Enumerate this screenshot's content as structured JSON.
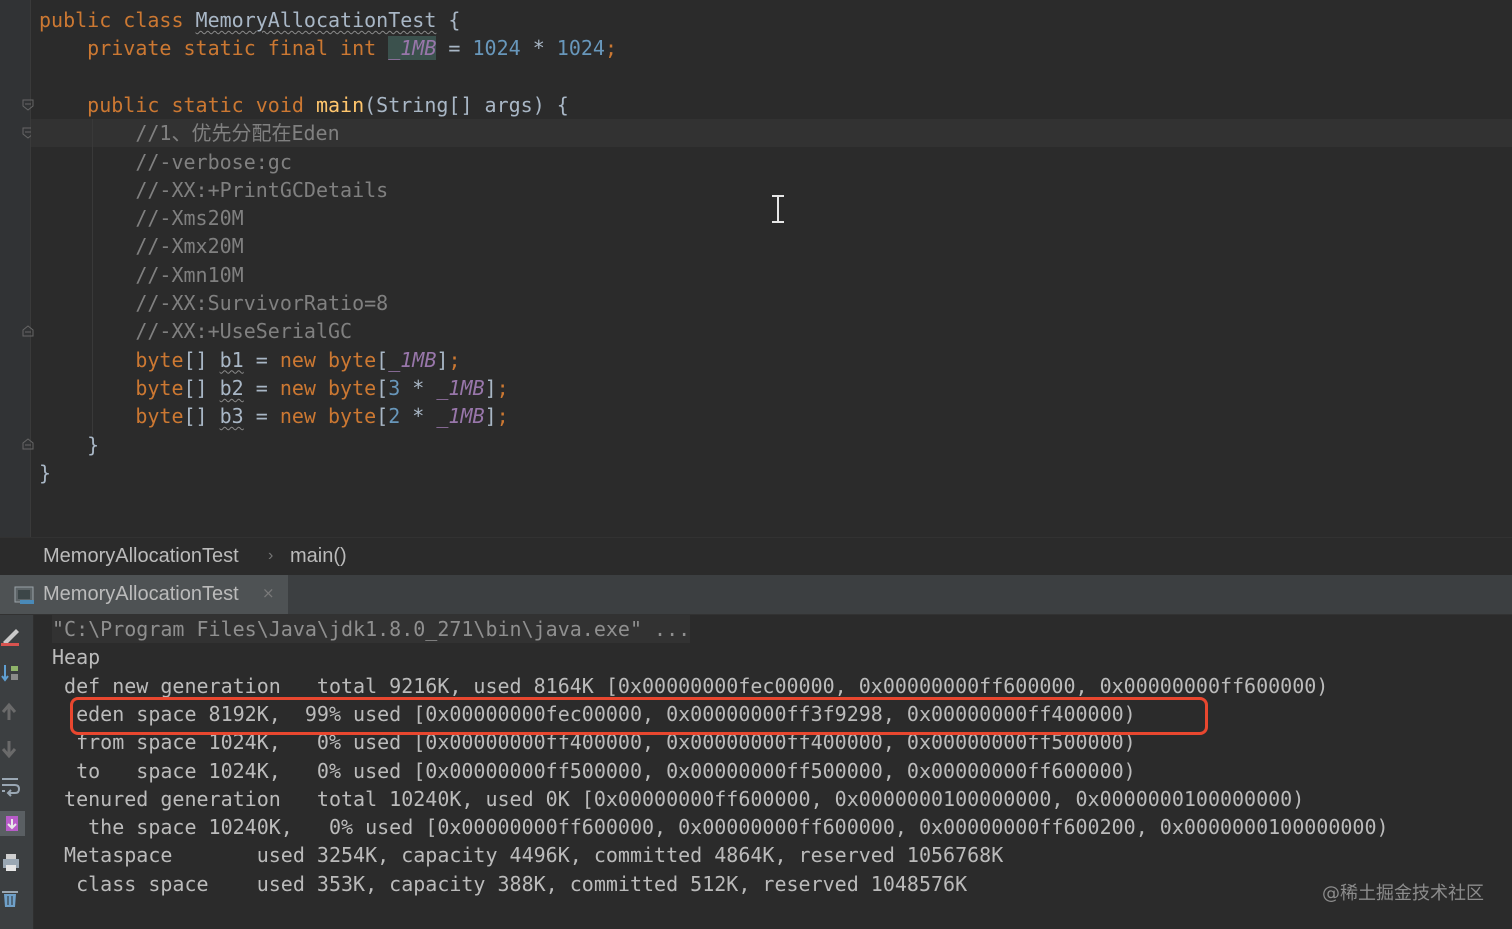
{
  "editor": {
    "lines": [
      {
        "segments": [
          {
            "t": "public class ",
            "c": "kw"
          },
          {
            "t": "MemoryAllocationTest",
            "c": "uline"
          },
          {
            "t": " {",
            "c": ""
          }
        ]
      },
      {
        "segments": [
          {
            "t": "    private static final int ",
            "c": "kw"
          },
          {
            "t": "_1MB",
            "c": "const-hl"
          },
          {
            "t": " = ",
            "c": ""
          },
          {
            "t": "1024",
            "c": "num"
          },
          {
            "t": " * ",
            "c": ""
          },
          {
            "t": "1024",
            "c": "num"
          },
          {
            "t": ";",
            "c": "kw"
          }
        ]
      },
      {
        "segments": []
      },
      {
        "segments": [
          {
            "t": "    public static void ",
            "c": "kw"
          },
          {
            "t": "main",
            "c": "fn"
          },
          {
            "t": "(String[] args) {",
            "c": ""
          }
        ]
      },
      {
        "segments": [
          {
            "t": "        //1、优先分配在Eden",
            "c": "cmt"
          }
        ]
      },
      {
        "segments": [
          {
            "t": "        //-verbose:gc",
            "c": "cmt"
          }
        ]
      },
      {
        "segments": [
          {
            "t": "        //-XX:+PrintGCDetails",
            "c": "cmt"
          }
        ]
      },
      {
        "segments": [
          {
            "t": "        //-Xms20M",
            "c": "cmt"
          }
        ]
      },
      {
        "segments": [
          {
            "t": "        //-Xmx20M",
            "c": "cmt"
          }
        ]
      },
      {
        "segments": [
          {
            "t": "        //-Xmn10M",
            "c": "cmt"
          }
        ]
      },
      {
        "segments": [
          {
            "t": "        //-XX:SurvivorRatio=8",
            "c": "cmt"
          }
        ]
      },
      {
        "segments": [
          {
            "t": "        //-XX:+UseSerialGC",
            "c": "cmt"
          }
        ]
      },
      {
        "segments": [
          {
            "t": "        byte",
            "c": "kw"
          },
          {
            "t": "[] ",
            "c": ""
          },
          {
            "t": "b1",
            "c": "uline"
          },
          {
            "t": " = ",
            "c": ""
          },
          {
            "t": "new byte",
            "c": "kw"
          },
          {
            "t": "[",
            "c": ""
          },
          {
            "t": "_1MB",
            "c": "const"
          },
          {
            "t": "]",
            "c": ""
          },
          {
            "t": ";",
            "c": "kw"
          }
        ]
      },
      {
        "segments": [
          {
            "t": "        byte",
            "c": "kw"
          },
          {
            "t": "[] ",
            "c": ""
          },
          {
            "t": "b2",
            "c": "uline"
          },
          {
            "t": " = ",
            "c": ""
          },
          {
            "t": "new byte",
            "c": "kw"
          },
          {
            "t": "[",
            "c": ""
          },
          {
            "t": "3",
            "c": "num"
          },
          {
            "t": " * ",
            "c": ""
          },
          {
            "t": "_1MB",
            "c": "const"
          },
          {
            "t": "]",
            "c": ""
          },
          {
            "t": ";",
            "c": "kw"
          }
        ]
      },
      {
        "segments": [
          {
            "t": "        byte",
            "c": "kw"
          },
          {
            "t": "[] ",
            "c": ""
          },
          {
            "t": "b3",
            "c": "uline"
          },
          {
            "t": " = ",
            "c": ""
          },
          {
            "t": "new byte",
            "c": "kw"
          },
          {
            "t": "[",
            "c": ""
          },
          {
            "t": "2",
            "c": "num"
          },
          {
            "t": " * ",
            "c": ""
          },
          {
            "t": "_1MB",
            "c": "const"
          },
          {
            "t": "]",
            "c": ""
          },
          {
            "t": ";",
            "c": "kw"
          }
        ]
      },
      {
        "segments": [
          {
            "t": "    }",
            "c": ""
          }
        ]
      },
      {
        "segments": [
          {
            "t": "}",
            "c": ""
          }
        ]
      }
    ]
  },
  "breadcrumb": {
    "class_name": "MemoryAllocationTest",
    "separator": "›",
    "method": "main()"
  },
  "run_tab": {
    "label": "MemoryAllocationTest",
    "close": "×"
  },
  "console": {
    "lines": [
      "\"C:\\Program Files\\Java\\jdk1.8.0_271\\bin\\java.exe\" ...",
      "Heap",
      " def new generation   total 9216K, used 8164K [0x00000000fec00000, 0x00000000ff600000, 0x00000000ff600000)",
      "  eden space 8192K,  99% used [0x00000000fec00000, 0x00000000ff3f9298, 0x00000000ff400000)",
      "  from space 1024K,   0% used [0x00000000ff400000, 0x00000000ff400000, 0x00000000ff500000)",
      "  to   space 1024K,   0% used [0x00000000ff500000, 0x00000000ff500000, 0x00000000ff600000)",
      " tenured generation   total 10240K, used 0K [0x00000000ff600000, 0x0000000100000000, 0x0000000100000000)",
      "   the space 10240K,   0% used [0x00000000ff600000, 0x00000000ff600000, 0x00000000ff600200, 0x0000000100000000)",
      " Metaspace       used 3254K, capacity 4496K, committed 4864K, reserved 1056768K",
      "  class space    used 353K, capacity 388K, committed 512K, reserved 1048576K"
    ]
  },
  "watermark": "@稀土掘金技术社区",
  "icons": [
    "fold-marker-icon",
    "text-caret-icon",
    "console-tab-icon",
    "close-icon",
    "edit-icon",
    "sort-icon",
    "arrow-up-icon",
    "arrow-down-icon",
    "soft-wrap-icon",
    "scroll-to-end-icon",
    "print-icon",
    "trash-icon"
  ],
  "colors": {
    "keyword": "#cc7832",
    "number": "#6897bb",
    "comment": "#808080",
    "function": "#ffc66d",
    "constant": "#9876aa",
    "highlight_box": "#e8472f"
  }
}
